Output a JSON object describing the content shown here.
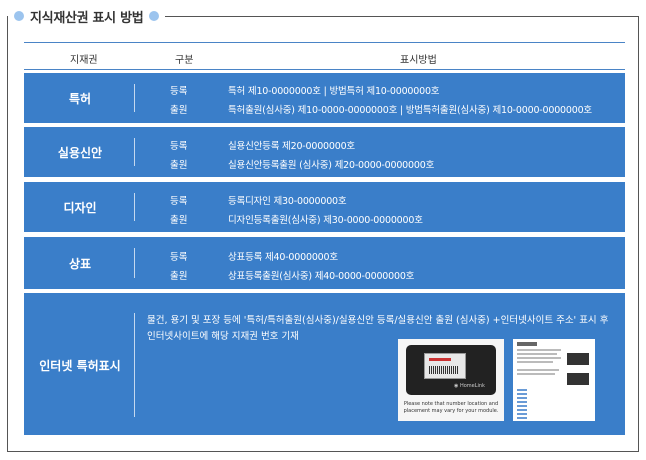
{
  "title": "지식재산권 표시 방법",
  "header": {
    "col1": "지재권",
    "col2": "구분",
    "col3": "표시방법"
  },
  "rows": [
    {
      "name": "특허",
      "lines": [
        {
          "kind": "등록",
          "text": "특허 제10-0000000호  |  방법특허 제10-0000000호"
        },
        {
          "kind": "출원",
          "text": "특허출원(심사중) 제10-0000-0000000호  |  방법특허출원(심사중) 제10-0000-0000000호"
        }
      ]
    },
    {
      "name": "실용신안",
      "lines": [
        {
          "kind": "등록",
          "text": "실용신안등록 제20-0000000호"
        },
        {
          "kind": "출원",
          "text": "실용신안등록출원 (심사중) 제20-0000-0000000호"
        }
      ]
    },
    {
      "name": "디자인",
      "lines": [
        {
          "kind": "등록",
          "text": "등록디자인 제30-0000000호"
        },
        {
          "kind": "출원",
          "text": "디자인등록출원(심사중) 제30-0000-0000000호"
        }
      ]
    },
    {
      "name": "상표",
      "lines": [
        {
          "kind": "등록",
          "text": "상표등록 제40-0000000호"
        },
        {
          "kind": "출원",
          "text": "상표등록출원(심사중) 제40-0000-0000000호"
        }
      ]
    }
  ],
  "internet": {
    "name": "인터넷 특허표시",
    "line1": "물건, 용기 및 포장 등에 '특허/특허출원(심사중)/실용신안 등록/실용신안 출원 (심사중) +인터넷사이트 주소' 표시 후",
    "line2": "인터넷사이트에 해당 지재권 번호 기재",
    "device_note": "Please note that number location and placement may vary for your module."
  }
}
